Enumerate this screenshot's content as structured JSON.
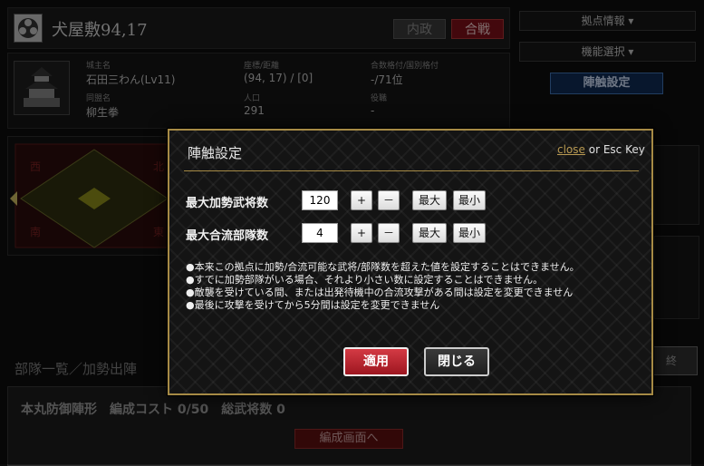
{
  "header": {
    "title": "犬屋敷94,17",
    "tab_naisei": "内政",
    "tab_kassen": "合戦"
  },
  "right_menu": {
    "base_info": "拠点情報 ▾",
    "function_select": "機能選択 ▾",
    "jinsho_button": "陣触設定"
  },
  "info": {
    "castle_owner_label": "城主名",
    "castle_owner": "石田三わん(Lv11)",
    "alliance_label": "同盟名",
    "alliance": "柳生拳",
    "coord_label": "座標/距離",
    "coord": "(94, 17) / [0]",
    "population_label": "人口",
    "population": "291",
    "rank_label": "合数格付/国別格付",
    "rank": "-/71位",
    "role_label": "役職",
    "role": "-"
  },
  "map": {
    "labels": [
      "西",
      "北",
      "南",
      "東"
    ]
  },
  "background": {
    "units_label": "部隊一覧／加勢出陣",
    "honmaru_title": "本丸防御陣形　編成コスト 0/50　総武将数 0",
    "henseigamen_button": "編成画面へ",
    "right_tab": "終"
  },
  "modal": {
    "title": "陣触設定",
    "close_link": "close",
    "close_suffix": " or Esc Key",
    "rows": [
      {
        "label": "最大加勢武将数",
        "value": "120"
      },
      {
        "label": "最大合流部隊数",
        "value": "4"
      }
    ],
    "plus": "+",
    "minus": "－",
    "max": "最大",
    "min": "最小",
    "notes": [
      "●本来この拠点に加勢/合流可能な武将/部隊数を超えた値を設定することはできません。",
      "●すでに加勢部隊がいる場合、それより小さい数に設定することはできません。",
      "●敵襲を受けている間、または出発待機中の合流攻撃がある間は設定を変更できません",
      "●最後に攻撃を受けてから5分間は設定を変更できません"
    ],
    "apply_button": "適用",
    "close_button": "閉じる"
  },
  "colors": {
    "modal_border": "#a68a45",
    "apply_red": "#c02530",
    "kassen_red": "#7a1018",
    "jinsho_blue": "#102a52"
  }
}
